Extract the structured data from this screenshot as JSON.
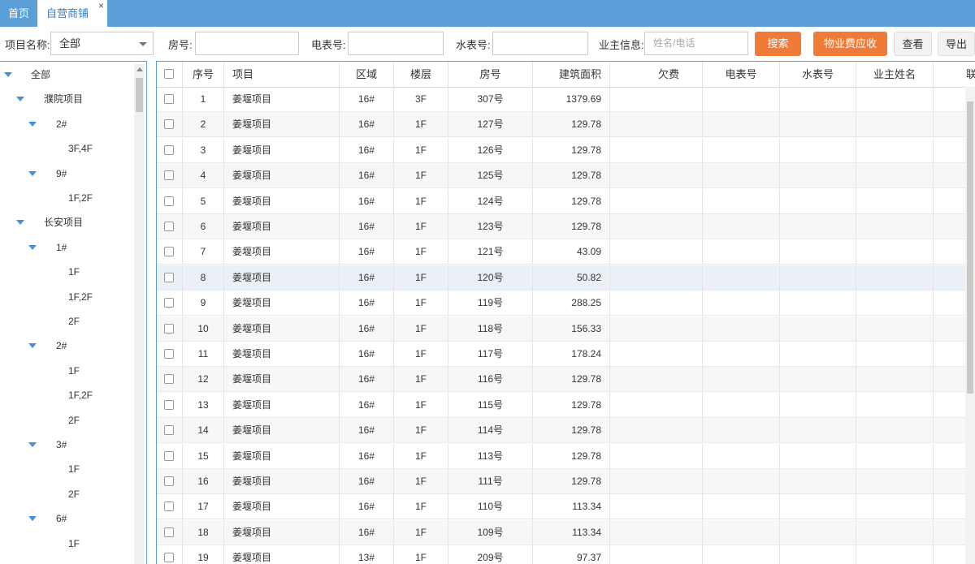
{
  "tabs": {
    "home": "首页",
    "active": "自营商铺",
    "close": "×"
  },
  "filter": {
    "project_label": "项目名称:",
    "project_value": "全部",
    "room_label": "房号:",
    "room_value": "",
    "elec_label": "电表号:",
    "elec_value": "",
    "water_label": "水表号:",
    "water_value": "",
    "owner_label": "业主信息:",
    "owner_placeholder": "姓名/电话",
    "search_btn": "搜索",
    "fee_btn": "物业费应收",
    "view_btn": "查看",
    "export_btn": "导出"
  },
  "tree": {
    "nodes": [
      {
        "label": "全部",
        "level": 0,
        "expanded": true
      },
      {
        "label": "濮院项目",
        "level": 1,
        "expanded": true
      },
      {
        "label": "2#",
        "level": 2,
        "expanded": true
      },
      {
        "label": "3F,4F",
        "level": 3
      },
      {
        "label": "9#",
        "level": 2,
        "expanded": true
      },
      {
        "label": "1F,2F",
        "level": 3
      },
      {
        "label": "长安项目",
        "level": 1,
        "expanded": true
      },
      {
        "label": "1#",
        "level": 2,
        "expanded": true
      },
      {
        "label": "1F",
        "level": 3
      },
      {
        "label": "1F,2F",
        "level": 3
      },
      {
        "label": "2F",
        "level": 3
      },
      {
        "label": "2#",
        "level": 2,
        "expanded": true
      },
      {
        "label": "1F",
        "level": 3
      },
      {
        "label": "1F,2F",
        "level": 3
      },
      {
        "label": "2F",
        "level": 3
      },
      {
        "label": "3#",
        "level": 2,
        "expanded": true
      },
      {
        "label": "1F",
        "level": 3
      },
      {
        "label": "2F",
        "level": 3
      },
      {
        "label": "6#",
        "level": 2,
        "expanded": true
      },
      {
        "label": "1F",
        "level": 3
      }
    ]
  },
  "grid": {
    "columns": [
      "序号",
      "项目",
      "区域",
      "楼层",
      "房号",
      "建筑面积",
      "欠费",
      "电表号",
      "水表号",
      "业主姓名",
      "联系"
    ],
    "rows": [
      {
        "no": "1",
        "project": "姜堰项目",
        "area": "16#",
        "floor": "3F",
        "room": "307号",
        "size": "1379.69"
      },
      {
        "no": "2",
        "project": "姜堰项目",
        "area": "16#",
        "floor": "1F",
        "room": "127号",
        "size": "129.78"
      },
      {
        "no": "3",
        "project": "姜堰项目",
        "area": "16#",
        "floor": "1F",
        "room": "126号",
        "size": "129.78"
      },
      {
        "no": "4",
        "project": "姜堰项目",
        "area": "16#",
        "floor": "1F",
        "room": "125号",
        "size": "129.78"
      },
      {
        "no": "5",
        "project": "姜堰项目",
        "area": "16#",
        "floor": "1F",
        "room": "124号",
        "size": "129.78"
      },
      {
        "no": "6",
        "project": "姜堰项目",
        "area": "16#",
        "floor": "1F",
        "room": "123号",
        "size": "129.78"
      },
      {
        "no": "7",
        "project": "姜堰项目",
        "area": "16#",
        "floor": "1F",
        "room": "121号",
        "size": "43.09"
      },
      {
        "no": "8",
        "project": "姜堰项目",
        "area": "16#",
        "floor": "1F",
        "room": "120号",
        "size": "50.82"
      },
      {
        "no": "9",
        "project": "姜堰项目",
        "area": "16#",
        "floor": "1F",
        "room": "119号",
        "size": "288.25"
      },
      {
        "no": "10",
        "project": "姜堰项目",
        "area": "16#",
        "floor": "1F",
        "room": "118号",
        "size": "156.33"
      },
      {
        "no": "11",
        "project": "姜堰项目",
        "area": "16#",
        "floor": "1F",
        "room": "117号",
        "size": "178.24"
      },
      {
        "no": "12",
        "project": "姜堰项目",
        "area": "16#",
        "floor": "1F",
        "room": "116号",
        "size": "129.78"
      },
      {
        "no": "13",
        "project": "姜堰项目",
        "area": "16#",
        "floor": "1F",
        "room": "115号",
        "size": "129.78"
      },
      {
        "no": "14",
        "project": "姜堰项目",
        "area": "16#",
        "floor": "1F",
        "room": "114号",
        "size": "129.78"
      },
      {
        "no": "15",
        "project": "姜堰项目",
        "area": "16#",
        "floor": "1F",
        "room": "113号",
        "size": "129.78"
      },
      {
        "no": "16",
        "project": "姜堰项目",
        "area": "16#",
        "floor": "1F",
        "room": "111号",
        "size": "129.78"
      },
      {
        "no": "17",
        "project": "姜堰项目",
        "area": "16#",
        "floor": "1F",
        "room": "110号",
        "size": "113.34"
      },
      {
        "no": "18",
        "project": "姜堰项目",
        "area": "16#",
        "floor": "1F",
        "room": "109号",
        "size": "113.34"
      },
      {
        "no": "19",
        "project": "姜堰项目",
        "area": "13#",
        "floor": "1F",
        "room": "209号",
        "size": "97.37"
      }
    ]
  }
}
